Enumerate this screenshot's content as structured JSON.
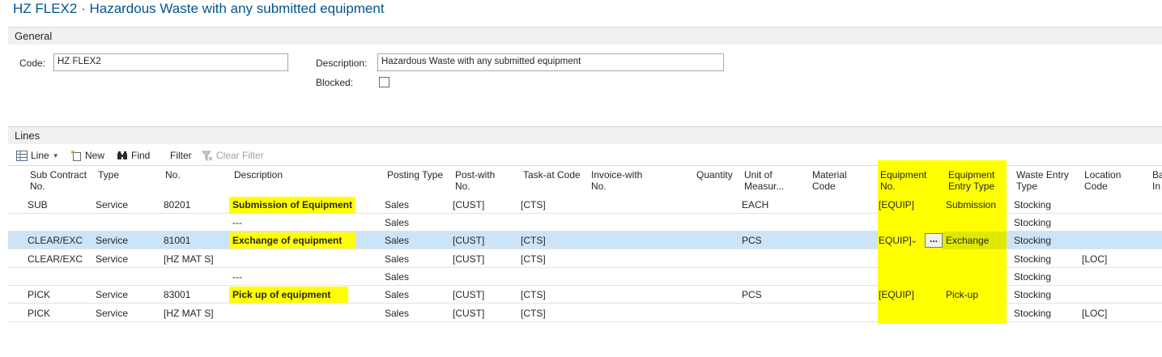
{
  "page": {
    "title": "HZ FLEX2 · Hazardous Waste with any submitted equipment"
  },
  "general": {
    "section_label": "General",
    "code_label": "Code:",
    "code_value": "HZ FLEX2",
    "description_label": "Description:",
    "description_value": "Hazardous Waste with any submitted equipment",
    "blocked_label": "Blocked:",
    "blocked_checked": false
  },
  "lines": {
    "section_label": "Lines",
    "toolbar": {
      "line_label": "Line",
      "line_icon": "grid-icon",
      "new_label": "New",
      "new_icon": "new-document-icon",
      "find_label": "Find",
      "find_icon": "binoculars-icon",
      "filter_label": "Filter",
      "clear_filter_label": "Clear Filter",
      "clear_filter_icon": "clear-filter-icon"
    },
    "columns": {
      "sub_contract_no": "Sub Contract No.",
      "type": "Type",
      "no": "No.",
      "description": "Description",
      "posting_type": "Posting Type",
      "post_with_no": "Post-with No.",
      "task_at_code": "Task-at Code",
      "invoice_with_no": "Invoice-with No.",
      "quantity": "Quantity",
      "unit_of_measure": "Unit of Measur...",
      "material_code": "Material Code",
      "equipment_no": "Equipment No.",
      "equipment_entry_type": "Equipment Entry Type",
      "waste_entry_type": "Waste Entry Type",
      "location_code": "Location Code",
      "cut_off": "Ba In"
    },
    "rows": [
      {
        "sub": "SUB",
        "type": "Service",
        "no": "80201",
        "desc": "Submission of Equipment",
        "desc_highlight": true,
        "posting": "Sales",
        "post_with": "[CUST]",
        "task_at": "[CTS]",
        "invoice_with": "",
        "qty": "",
        "uom": "EACH",
        "material": "",
        "equip_no": "[EQUIP]",
        "equip_entry": "Submission",
        "waste_entry": "Stocking",
        "location": ""
      },
      {
        "sub": "",
        "type": "",
        "no": "",
        "desc": "---",
        "desc_highlight": false,
        "posting": "Sales",
        "post_with": "",
        "task_at": "",
        "invoice_with": "",
        "qty": "",
        "uom": "",
        "material": "",
        "equip_no": "",
        "equip_entry": "",
        "waste_entry": "Stocking",
        "location": ""
      },
      {
        "sub": "CLEAR/EXC",
        "type": "Service",
        "no": "81001",
        "desc": "Exchange of equipment",
        "desc_highlight": true,
        "posting": "Sales",
        "post_with": "[CUST]",
        "task_at": "[CTS]",
        "invoice_with": "",
        "qty": "",
        "uom": "PCS",
        "material": "",
        "equip_no": "EQUIP]",
        "equip_entry": "Exchange",
        "waste_entry": "Stocking",
        "location": "",
        "selected": true
      },
      {
        "sub": "CLEAR/EXC",
        "type": "Service",
        "no": "[HZ MAT S]",
        "desc": "",
        "desc_highlight": false,
        "posting": "Sales",
        "post_with": "[CUST]",
        "task_at": "[CTS]",
        "invoice_with": "",
        "qty": "",
        "uom": "",
        "material": "",
        "equip_no": "",
        "equip_entry": "",
        "waste_entry": "Stocking",
        "location": "[LOC]"
      },
      {
        "sub": "",
        "type": "",
        "no": "",
        "desc": "---",
        "desc_highlight": false,
        "posting": "Sales",
        "post_with": "",
        "task_at": "",
        "invoice_with": "",
        "qty": "",
        "uom": "",
        "material": "",
        "equip_no": "",
        "equip_entry": "",
        "waste_entry": "Stocking",
        "location": ""
      },
      {
        "sub": "PICK",
        "type": "Service",
        "no": "83001",
        "desc": "Pick up of equipment",
        "desc_highlight": true,
        "posting": "Sales",
        "post_with": "[CUST]",
        "task_at": "[CTS]",
        "invoice_with": "",
        "qty": "",
        "uom": "PCS",
        "material": "",
        "equip_no": "[EQUIP]",
        "equip_entry": "Pick-up",
        "waste_entry": "Stocking",
        "location": ""
      },
      {
        "sub": "PICK",
        "type": "Service",
        "no": "[HZ MAT S]",
        "desc": "",
        "desc_highlight": false,
        "posting": "Sales",
        "post_with": "[CUST]",
        "task_at": "[CTS]",
        "invoice_with": "",
        "qty": "",
        "uom": "",
        "material": "",
        "equip_no": "",
        "equip_entry": "",
        "waste_entry": "Stocking",
        "location": "[LOC]"
      }
    ],
    "assist_button_label": "...",
    "dropdown_icon": "chevron-down-icon"
  },
  "colors": {
    "title": "#00558d",
    "highlight": "#ffff00",
    "selected_row": "#cce4f7",
    "section_bar": "#f0f0f0"
  }
}
